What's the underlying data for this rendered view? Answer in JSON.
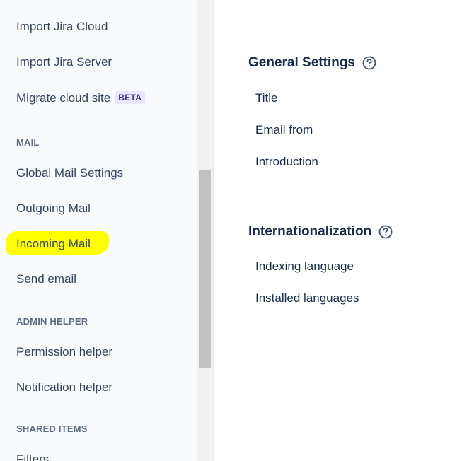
{
  "sidebar": {
    "items": [
      {
        "label": "Import Jira Cloud"
      },
      {
        "label": "Import Jira Server"
      },
      {
        "label": "Migrate cloud site",
        "badge": "BETA"
      }
    ],
    "sections": [
      {
        "title": "MAIL",
        "items": [
          {
            "label": "Global Mail Settings"
          },
          {
            "label": "Outgoing Mail"
          },
          {
            "label": "Incoming Mail",
            "highlighted": true
          },
          {
            "label": "Send email"
          }
        ]
      },
      {
        "title": "ADMIN HELPER",
        "items": [
          {
            "label": "Permission helper"
          },
          {
            "label": "Notification helper"
          }
        ]
      },
      {
        "title": "SHARED ITEMS",
        "items": [
          {
            "label": "Filters"
          }
        ]
      }
    ]
  },
  "main": {
    "general": {
      "title": "General Settings",
      "rows": [
        {
          "label": "Title"
        },
        {
          "label": "Email from"
        },
        {
          "label": "Introduction"
        }
      ]
    },
    "i18n": {
      "title": "Internationalization",
      "rows": [
        {
          "label": "Indexing language"
        },
        {
          "label": "Installed languages"
        }
      ]
    }
  },
  "colors": {
    "highlight": "#ffff00",
    "badge_bg": "#eae6ff",
    "badge_text": "#403294",
    "sidebar_bg": "#f9fafc",
    "scroll_thumb": "#c1c1c1"
  }
}
